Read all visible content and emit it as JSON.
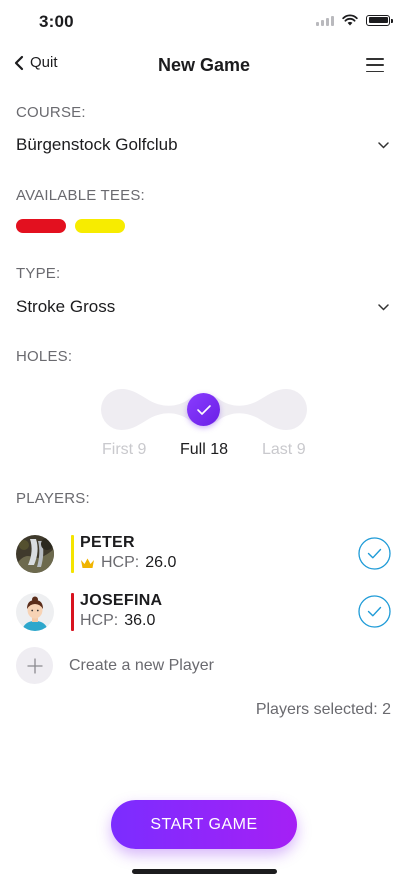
{
  "status_bar": {
    "time": "3:00"
  },
  "nav": {
    "back_label": "Quit",
    "title": "New Game"
  },
  "course": {
    "label": "COURSE:",
    "value": "Bürgenstock Golfclub"
  },
  "tees": {
    "label": "AVAILABLE TEES:",
    "colors": [
      "#e3101f",
      "#f7ec00"
    ]
  },
  "type": {
    "label": "TYPE:",
    "value": "Stroke Gross"
  },
  "holes": {
    "label": "HOLES:",
    "options": [
      "First 9",
      "Full 18",
      "Last 9"
    ],
    "selected": "Full 18"
  },
  "players": {
    "label": "PLAYERS:",
    "items": [
      {
        "name": "PETER",
        "hcp_label": "HCP:",
        "hcp": "26.0",
        "bar_color": "#f4e400",
        "leader": true,
        "selected": true
      },
      {
        "name": "JOSEFINA",
        "hcp_label": "HCP:",
        "hcp": "36.0",
        "bar_color": "#d8131f",
        "leader": false,
        "selected": true
      }
    ],
    "create_label": "Create a new Player",
    "selected_text": "Players selected: 2"
  },
  "start_button": {
    "label": "START GAME"
  },
  "colors": {
    "accent": "#7b2dff",
    "check": "#1e9bd7",
    "crown": "#f0b400"
  }
}
